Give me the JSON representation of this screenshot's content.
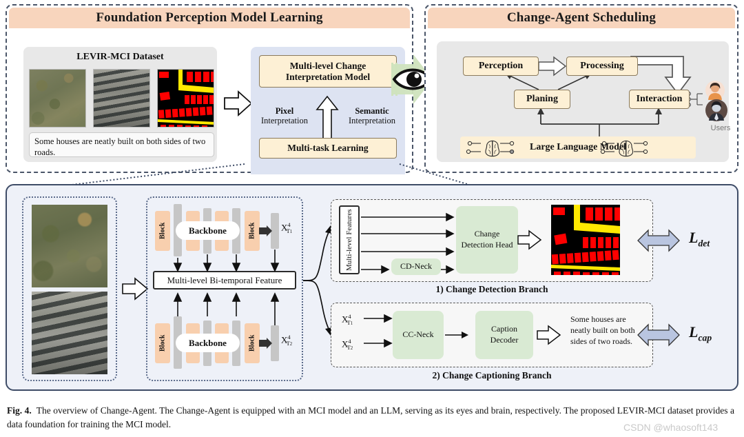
{
  "top_left": {
    "title": "Foundation Perception Model Learning",
    "dataset_title": "LEVIR-MCI Dataset",
    "caption": "Some houses are neatly built on both sides of two roads.",
    "thumbnails": [
      "pre-change-aerial-image",
      "post-change-aerial-image",
      "change-mask-image"
    ],
    "model_box": "Multi-level Change Interpretation Model",
    "left_label_bold": "Pixel",
    "left_label_rest": "Interpretation",
    "right_label_bold": "Semantic",
    "right_label_rest": "Interpretation",
    "bottom_box": "Multi-task Learning"
  },
  "top_right": {
    "title": "Change-Agent Scheduling",
    "nodes": {
      "perception": "Perception",
      "processing": "Processing",
      "planing": "Planing",
      "interaction": "Interaction"
    },
    "llm_bar": "Large Language Model",
    "users_label": "Users",
    "icons": {
      "eye": "eye-icon",
      "brain": "brain-icon",
      "avatar": "user-avatar-icon"
    }
  },
  "detail": {
    "encoder": {
      "block_label": "Block",
      "backbone_label": "Backbone",
      "out_t1": "X",
      "out_t1_sup": "4",
      "out_t1_sub": "T",
      "out_t1_sub2": "1",
      "out_t2_sub2": "2",
      "feature_bus": "Multi-level Bi-temporal Feature"
    },
    "detection_branch": {
      "features_label": "Multi-level Features",
      "neck": "CD-Neck",
      "head": "Change Detection Head",
      "output_image": "change-detection-mask",
      "loss": "L",
      "loss_sub": "det",
      "branch_title": "1) Change Detection Branch"
    },
    "captioning_branch": {
      "input_1": "X",
      "input_1_sup": "4",
      "input_1_sub": "T",
      "input_1_sub2": "1",
      "input_2_sub2": "2",
      "neck": "CC-Neck",
      "decoder": "Caption Decoder",
      "output_text": "Some houses are neatly built on both sides of two roads.",
      "loss": "L",
      "loss_sub": "cap",
      "branch_title": "2) Change Captioning Branch"
    }
  },
  "figure_caption": {
    "label": "Fig. 4.",
    "text": "The overview of Change-Agent. The Change-Agent is equipped with an MCI model and an LLM, serving as its eyes and brain, respectively. The proposed LEVIR-MCI dataset provides a data foundation for training the MCI model."
  },
  "watermark": "CSDN @whaosoft143",
  "colors": {
    "header_peach": "#f8d5bd",
    "cream_box": "#fdf0d5",
    "panel_gray": "#e8e8e8",
    "panel_blue": "#dde3f2",
    "green_box": "#d9ead3",
    "peach_block": "#f8cfae",
    "gray_block": "#c6c6c6",
    "loss_arrow": "#b9c5e0",
    "bottom_bg": "#eef1f8"
  }
}
